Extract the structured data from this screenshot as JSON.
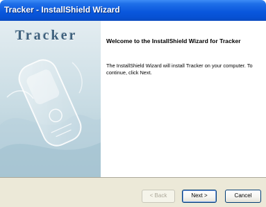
{
  "window": {
    "title": "Tracker - InstallShield Wizard"
  },
  "side_panel": {
    "brand": "Tracker"
  },
  "main": {
    "heading": "Welcome to the InstallShield Wizard for Tracker",
    "body": "The InstallShield Wizard will install Tracker on your computer.  To continue, click Next."
  },
  "buttons": {
    "back": "< Back",
    "next": "Next >",
    "cancel": "Cancel"
  },
  "colors": {
    "title_bar": "#0a58dd",
    "footer": "#ece9d8",
    "brand_text": "#3d607c"
  }
}
